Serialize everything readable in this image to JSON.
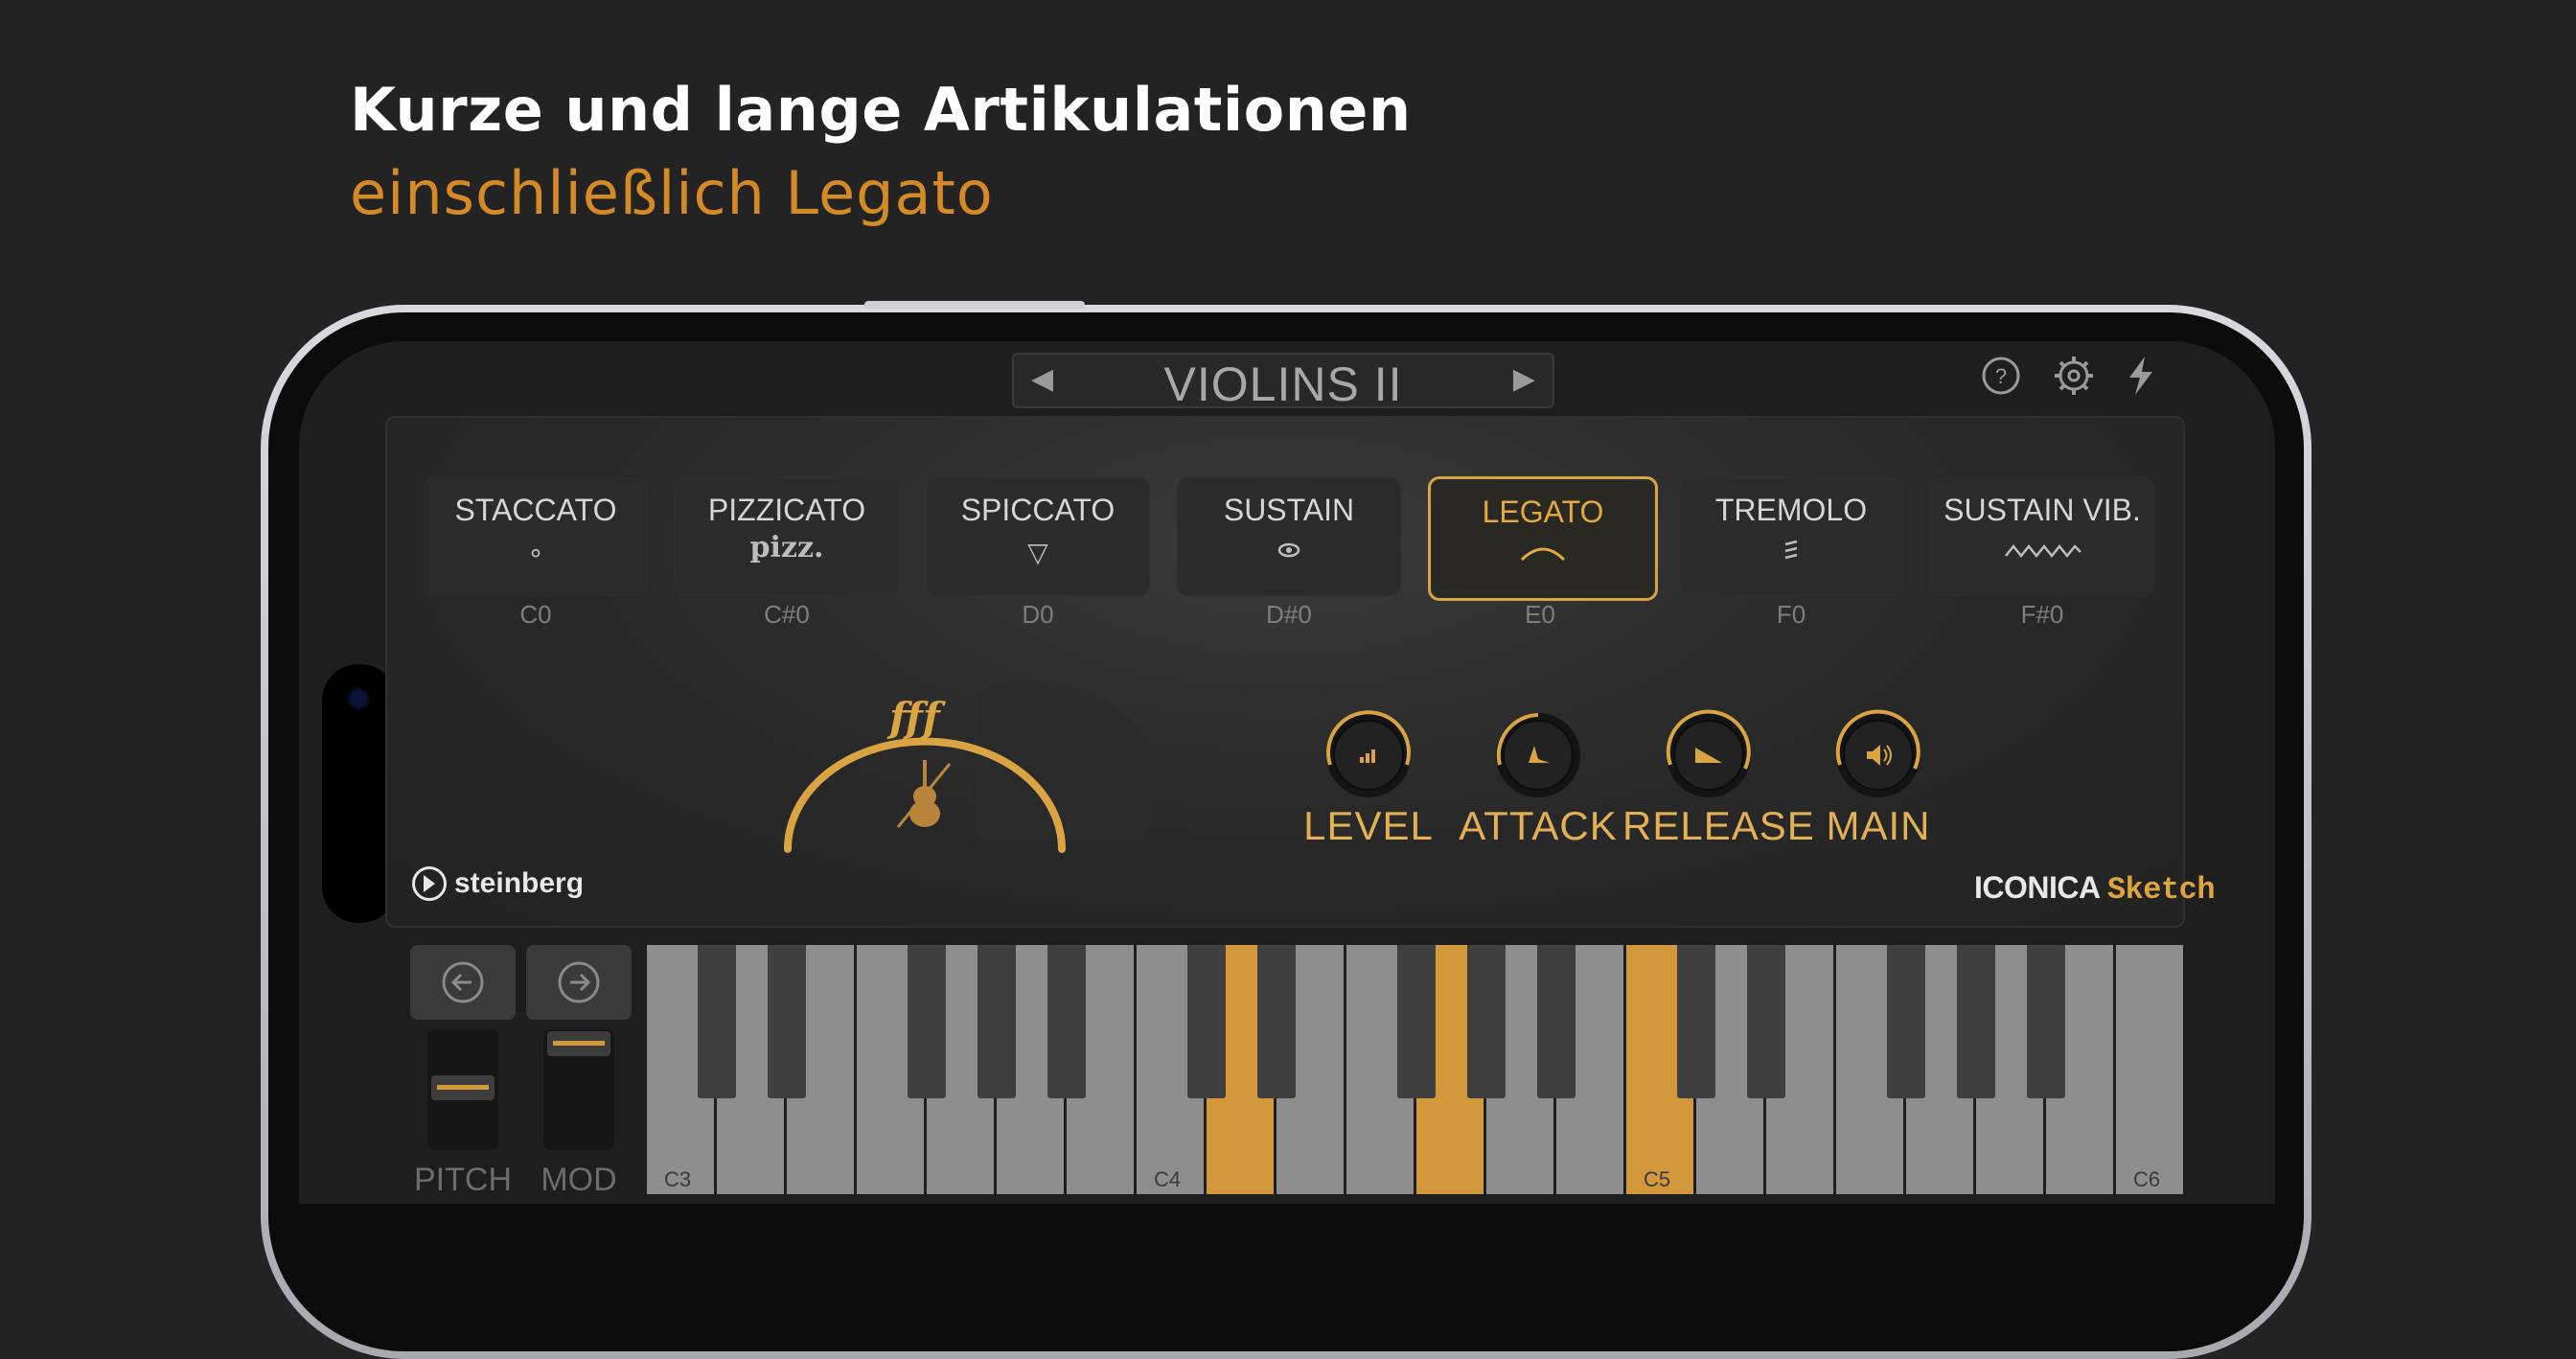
{
  "headline": "Kurze und lange Artikulationen",
  "subline": "einschließlich Legato",
  "preset": {
    "prev_icon": "left-triangle-icon",
    "name": "VIOLINS II",
    "next_icon": "right-triangle-icon"
  },
  "top_icons": [
    "help-icon",
    "settings-icon",
    "power-icon"
  ],
  "articulations": [
    {
      "label": "STACCATO",
      "symbol": "∘",
      "key": "C0"
    },
    {
      "label": "PIZZICATO",
      "symbol": "pizz.",
      "key": "C#0"
    },
    {
      "label": "SPICCATO",
      "symbol": "▽",
      "key": "D0"
    },
    {
      "label": "SUSTAIN",
      "symbol": "",
      "key": "D#0"
    },
    {
      "label": "LEGATO",
      "symbol": "",
      "key": "E0",
      "active": true
    },
    {
      "label": "TREMOLO",
      "symbol": "",
      "key": "F0"
    },
    {
      "label": "SUSTAIN VIB.",
      "symbol": "",
      "key": "F#0"
    }
  ],
  "dynamics": {
    "text": "fff",
    "level": 1.0
  },
  "knobs": [
    {
      "label": "LEVEL",
      "icon": "level-bars-icon"
    },
    {
      "label": "ATTACK",
      "icon": "attack-envelope-icon"
    },
    {
      "label": "RELEASE",
      "icon": "release-envelope-icon"
    },
    {
      "label": "MAIN",
      "icon": "speaker-icon"
    }
  ],
  "brand": {
    "steinberg": "steinberg",
    "iconica": "ICONICA",
    "sketch": "Sketch"
  },
  "wheels": {
    "pitch": "PITCH",
    "mod": "MOD"
  },
  "keyboard": {
    "labels": [
      "C3",
      "C4",
      "C5",
      "C6"
    ],
    "pressed_white": [
      "C4 #5",
      "C4 #7",
      "C5"
    ]
  },
  "colors": {
    "accent": "#d9a441",
    "headline_orange": "#d58a25"
  }
}
